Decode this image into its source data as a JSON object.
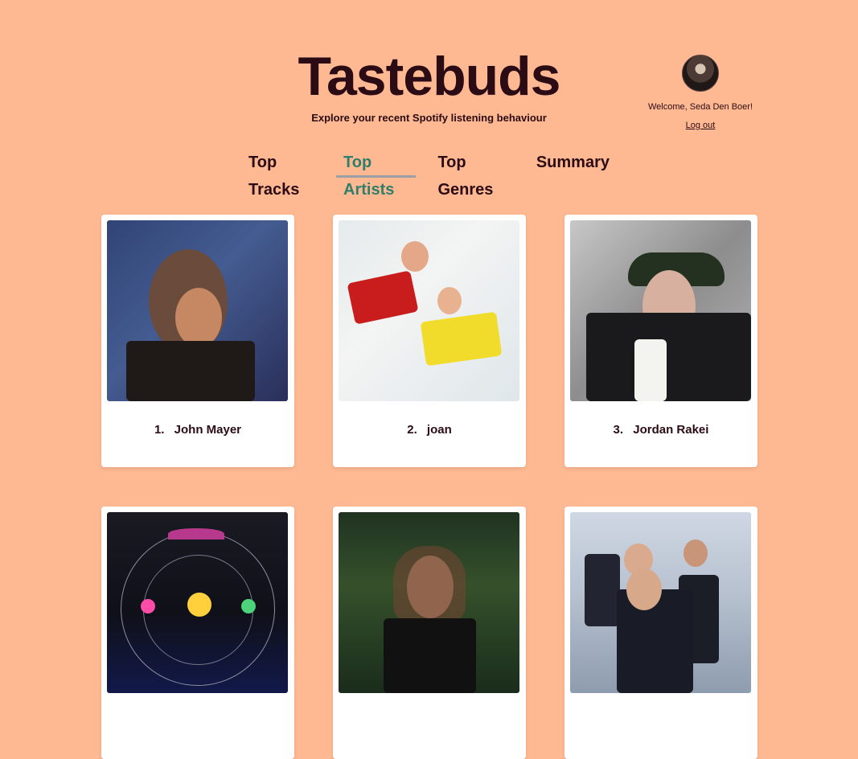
{
  "header": {
    "title": "Tastebuds",
    "subtitle": "Explore your recent Spotify listening behaviour"
  },
  "user": {
    "welcome_text": "Welcome, Seda Den Boer!",
    "logout_label": "Log out"
  },
  "tabs": [
    {
      "label": "Top Tracks",
      "active": false
    },
    {
      "label": "Top Artists",
      "active": true
    },
    {
      "label": "Top Genres",
      "active": false
    },
    {
      "label": "Summary",
      "active": false
    }
  ],
  "artists": [
    {
      "rank": "1.",
      "name": "John Mayer"
    },
    {
      "rank": "2.",
      "name": "joan"
    },
    {
      "rank": "3.",
      "name": "Jordan Rakei"
    },
    {
      "rank": "",
      "name": ""
    },
    {
      "rank": "",
      "name": ""
    },
    {
      "rank": "",
      "name": ""
    }
  ],
  "colors": {
    "background": "#ffb992",
    "text": "#2b0b14",
    "active_tab": "#2e7f6b"
  }
}
